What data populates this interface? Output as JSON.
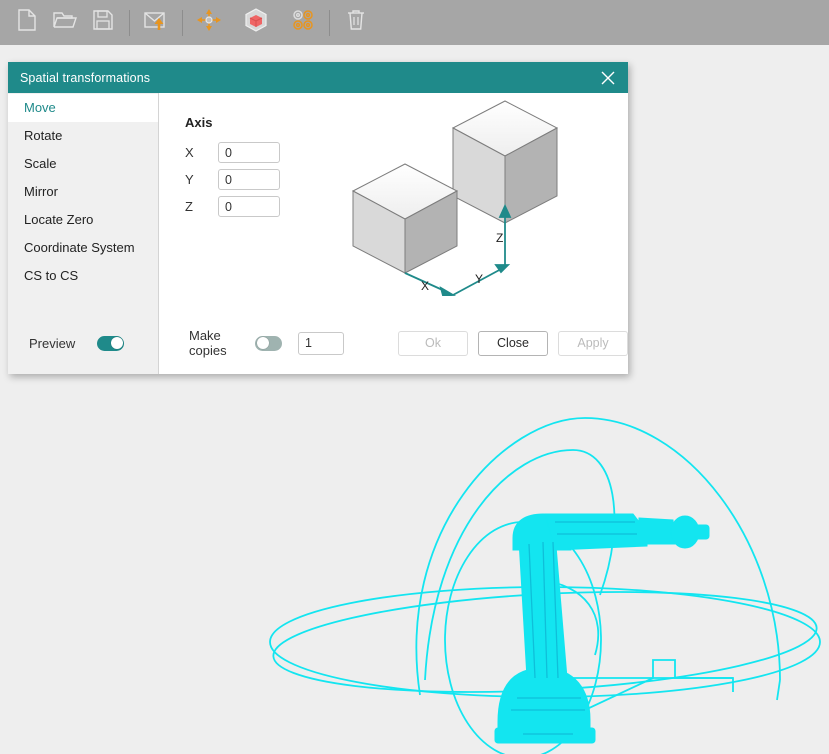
{
  "toolbar": {
    "items": [
      {
        "name": "new-file-icon",
        "label": "New"
      },
      {
        "name": "open-folder-icon",
        "label": "Open"
      },
      {
        "name": "save-disk-icon",
        "label": "Save"
      },
      {
        "name": "import-export-icon",
        "label": "Import"
      },
      {
        "name": "move-axes-icon",
        "label": "Move"
      },
      {
        "name": "cube-solid-icon",
        "label": "Solid"
      },
      {
        "name": "targets-grid-icon",
        "label": "Targets"
      },
      {
        "name": "trash-delete-icon",
        "label": "Delete"
      }
    ]
  },
  "dialog": {
    "title": "Spatial transformations",
    "close_icon": "close-icon",
    "sidebar": {
      "items": [
        {
          "label": "Move",
          "selected": true
        },
        {
          "label": "Rotate",
          "selected": false
        },
        {
          "label": "Scale",
          "selected": false
        },
        {
          "label": "Mirror",
          "selected": false
        },
        {
          "label": "Locate Zero",
          "selected": false
        },
        {
          "label": "Coordinate System",
          "selected": false
        },
        {
          "label": "CS to CS",
          "selected": false
        }
      ],
      "preview_label": "Preview",
      "preview_on": true
    },
    "content": {
      "section_title": "Axis",
      "fields": [
        {
          "label": "X",
          "value": "0"
        },
        {
          "label": "Y",
          "value": "0"
        },
        {
          "label": "Z",
          "value": "0"
        }
      ],
      "illustration": {
        "name": "move-cubes-illustration",
        "axis_labels": {
          "x": "X",
          "y": "Y",
          "z": "Z"
        }
      }
    },
    "footer": {
      "make_copies_label": "Make copies",
      "make_copies_on": false,
      "copies_value": "1",
      "ok_label": "Ok",
      "ok_enabled": false,
      "close_label": "Close",
      "close_enabled": true,
      "apply_label": "Apply",
      "apply_enabled": false
    }
  },
  "viewport": {
    "model_name": "robot-arm-wireframe",
    "wire_color": "#13e5f0",
    "background_color": "#eeeeee"
  },
  "colors": {
    "accent_teal": "#1f8a8a",
    "toolbar_gray": "#a6a6a6",
    "sidebar_gray": "#f0f0f0"
  }
}
